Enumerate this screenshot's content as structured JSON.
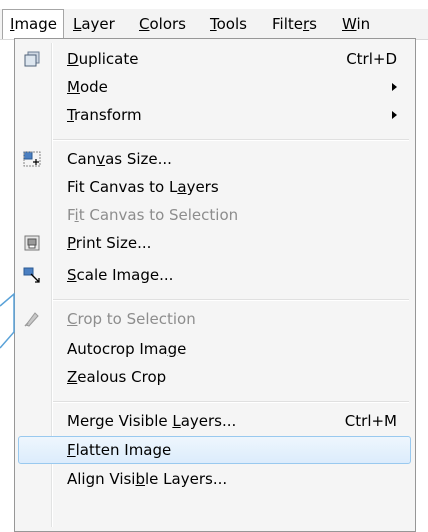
{
  "menubar": {
    "items": [
      {
        "label": "Image",
        "active": true
      },
      {
        "label": "Layer",
        "active": false
      },
      {
        "label": "Colors",
        "active": false
      },
      {
        "label": "Tools",
        "active": false
      },
      {
        "label": "Filters",
        "active": false
      },
      {
        "label": "Win",
        "active": false
      }
    ]
  },
  "menu": {
    "items": [
      {
        "label": "Duplicate",
        "shortcut": "Ctrl+D",
        "icon": "duplicate-icon"
      },
      {
        "label": "Mode",
        "submenu": true
      },
      {
        "label": "Transform",
        "submenu": true
      },
      {
        "label": "Canvas Size...",
        "icon": "canvas-size-icon"
      },
      {
        "label": "Fit Canvas to Layers"
      },
      {
        "label": "Fit Canvas to Selection",
        "disabled": true
      },
      {
        "label": "Print Size...",
        "icon": "print-size-icon"
      },
      {
        "label": "Scale Image...",
        "icon": "scale-image-icon"
      },
      {
        "label": "Crop to Selection",
        "disabled": true,
        "icon": "crop-icon"
      },
      {
        "label": "Autocrop Image"
      },
      {
        "label": "Zealous Crop"
      },
      {
        "label": "Merge Visible Layers...",
        "shortcut": "Ctrl+M"
      },
      {
        "label": "Flatten Image",
        "highlighted": true
      },
      {
        "label": "Align Visible Layers..."
      }
    ]
  },
  "colors": {
    "highlight_border": "#99c9ef",
    "highlight_fill": "#dcecfc",
    "disabled_text": "#8d8d8d",
    "menu_background": "#f5f5f5"
  }
}
